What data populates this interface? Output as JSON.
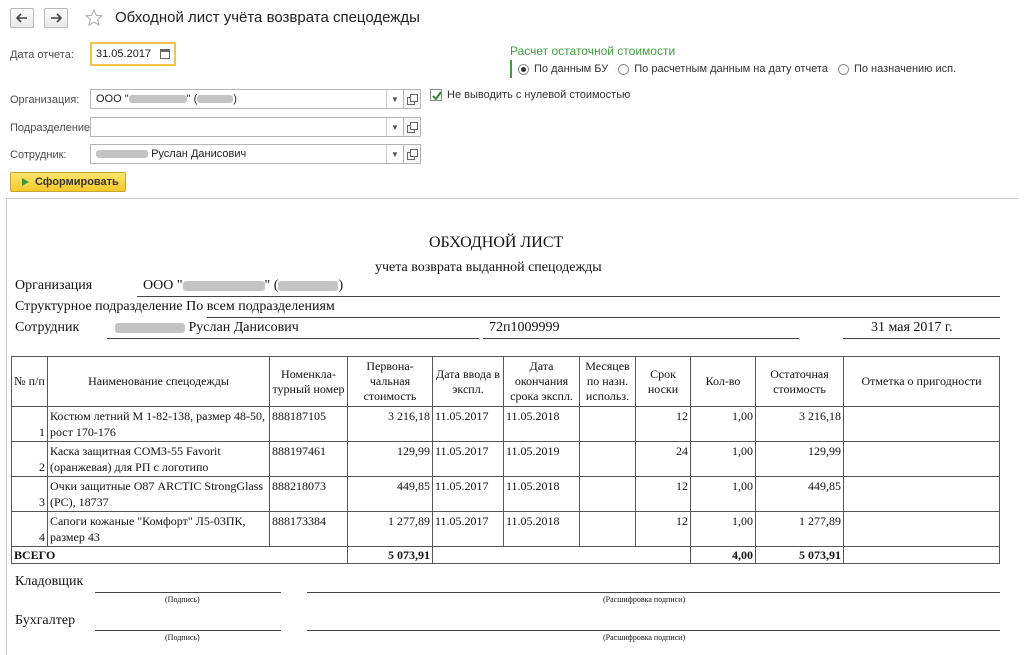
{
  "window": {
    "title": "Обходной лист учёта возврата спецодежды"
  },
  "form": {
    "date_label": "Дата отчета:",
    "date_value": "31.05.2017",
    "org_label": "Организация:",
    "org_value_prefix": "ООО \"",
    "org_value_mid": "\" (",
    "org_value_suffix": ")",
    "dept_label": "Подразделение:",
    "dept_value": "",
    "employee_label": "Сотрудник:",
    "employee_value": "Руслан Данисович",
    "calc_title": "Расчет остаточной стоимости",
    "calc_options": [
      "По данным БУ",
      "По расчетным данным на дату отчета",
      "По назначению исп."
    ],
    "calc_selected": "По данным БУ",
    "checkbox_label": "Не выводить с нулевой стоимостью",
    "checkbox_checked": true,
    "generate_label": "Сформировать"
  },
  "report": {
    "title": "ОБХОДНОЙ ЛИСТ",
    "subtitle": "учета возврата выданной спецодежды",
    "org_label": "Организация",
    "org_value_prefix": "ООО \"",
    "org_value_mid": "\" (",
    "org_value_suffix": ")",
    "dept_line": "Структурное подразделение По всем подразделениям",
    "employee_label": "Сотрудник",
    "employee_value": "Руслан Данисович",
    "employee_number": "72п1009999",
    "date": "31 мая 2017 г.",
    "columns": [
      "№ п/п",
      "Наименование спецодежды",
      "Номенкла-турный номер",
      "Первона-чальная стоимость",
      "Дата ввода в экспл.",
      "Дата окончания срока экспл.",
      "Месяцев по назн. использ.",
      "Срок носки",
      "Кол-во",
      "Остаточная стоимость",
      "Отметка о пригодности"
    ],
    "rows": [
      {
        "n": "1",
        "name": "Костюм летний М 1-82-138, размер 48-50, рост 170-176",
        "code": "888187105",
        "initial_cost": "3 216,18",
        "start_date": "11.05.2017",
        "end_date": "11.05.2018",
        "months": "",
        "wear_term": "12",
        "qty": "1,00",
        "residual": "3 216,18",
        "mark": ""
      },
      {
        "n": "2",
        "name": "Каска защитная СОМЗ-55 Favorit (оранжевая) для РП с логотипо",
        "code": "888197461",
        "initial_cost": "129,99",
        "start_date": "11.05.2017",
        "end_date": "11.05.2019",
        "months": "",
        "wear_term": "24",
        "qty": "1,00",
        "residual": "129,99",
        "mark": ""
      },
      {
        "n": "3",
        "name": "Очки защитные О87 ARCTIC StrongGlass (PC), 18737",
        "code": "888218073",
        "initial_cost": "449,85",
        "start_date": "11.05.2017",
        "end_date": "11.05.2018",
        "months": "",
        "wear_term": "12",
        "qty": "1,00",
        "residual": "449,85",
        "mark": ""
      },
      {
        "n": "4",
        "name": "Сапоги кожаные \"Комфорт\" Л5-03ПК, размер 43",
        "code": "888173384",
        "initial_cost": "1 277,89",
        "start_date": "11.05.2017",
        "end_date": "11.05.2018",
        "months": "",
        "wear_term": "12",
        "qty": "1,00",
        "residual": "1 277,89",
        "mark": ""
      }
    ],
    "total": {
      "label": "ВСЕГО",
      "initial_cost": "5 073,91",
      "qty": "4,00",
      "residual": "5 073,91"
    },
    "storekeeper_label": "Кладовщик",
    "accountant_label": "Бухгалтер",
    "signature_caption": "(Подпись)",
    "decode_caption": "(Расшифровка подписи)"
  }
}
